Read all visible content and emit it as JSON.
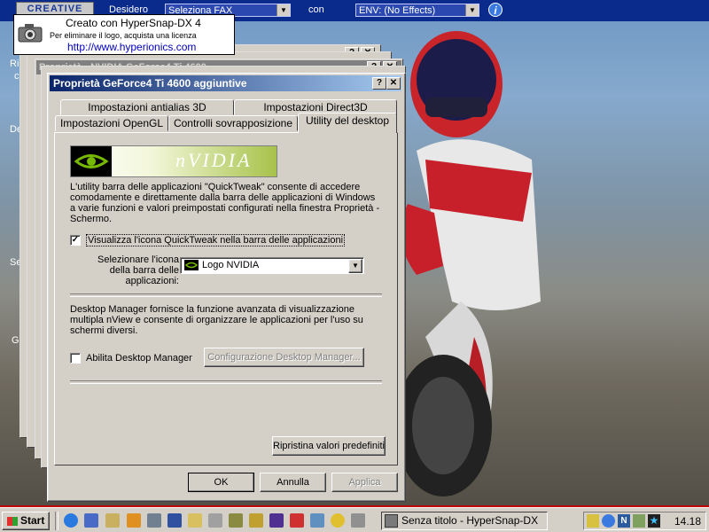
{
  "topbar": {
    "logo": "CREATIVE",
    "desidero": "Desidero",
    "combo1": "Seleziona FAX",
    "con": "con",
    "combo2": "ENV: (No Effects)"
  },
  "watermark": {
    "line1": "Creato con HyperSnap-DX 4",
    "line2": "Per eliminare il logo, acquista una licenza",
    "line3": "http://www.hyperionics.com"
  },
  "bg_window": {
    "title": "Proprietà - NVIDIA GeForce4 Ti 4600",
    "desktop_letters": [
      "Ri",
      "c",
      "De",
      "Se",
      "G"
    ]
  },
  "dialog": {
    "title": "Proprietà GeForce4 Ti 4600 aggiuntive",
    "tabs_row1": [
      "Impostazioni antialias 3D",
      "Impostazioni Direct3D"
    ],
    "tabs_row2": [
      "Impostazioni OpenGL",
      "Controlli sovrapposizione",
      "Utility del desktop"
    ],
    "nvidia_logo": "nVIDIA",
    "quicktweak_desc": "L'utility barra delle applicazioni \"QuickTweak\" consente di accedere comodamente e direttamente dalla barra delle applicazioni di Windows a varie funzioni e valori preimpostati configurati nella finestra Proprietà - Schermo.",
    "show_icon_label": "Visualizza l'icona QuickTweak nella barra delle applicazioni",
    "show_icon_checked": "✓",
    "select_icon_label": "Selezionare l'icona della barra delle applicazioni:",
    "select_icon_value": "Logo NVIDIA",
    "desktop_manager_desc": "Desktop Manager fornisce la funzione avanzata di visualizzazione multipla nView e consente di organizzare le applicazioni per l'uso su schermi diversi.",
    "enable_dm_label": "Abilita Desktop Manager",
    "configure_dm_button": "Configurazione Desktop Manager...",
    "restore_button": "Ripristina valori predefiniti",
    "ok_button": "OK",
    "cancel_button": "Annulla",
    "apply_button": "Applica"
  },
  "taskbar": {
    "start": "Start",
    "task_button": "Senza titolo - HyperSnap-DX",
    "clock": "14.18"
  }
}
